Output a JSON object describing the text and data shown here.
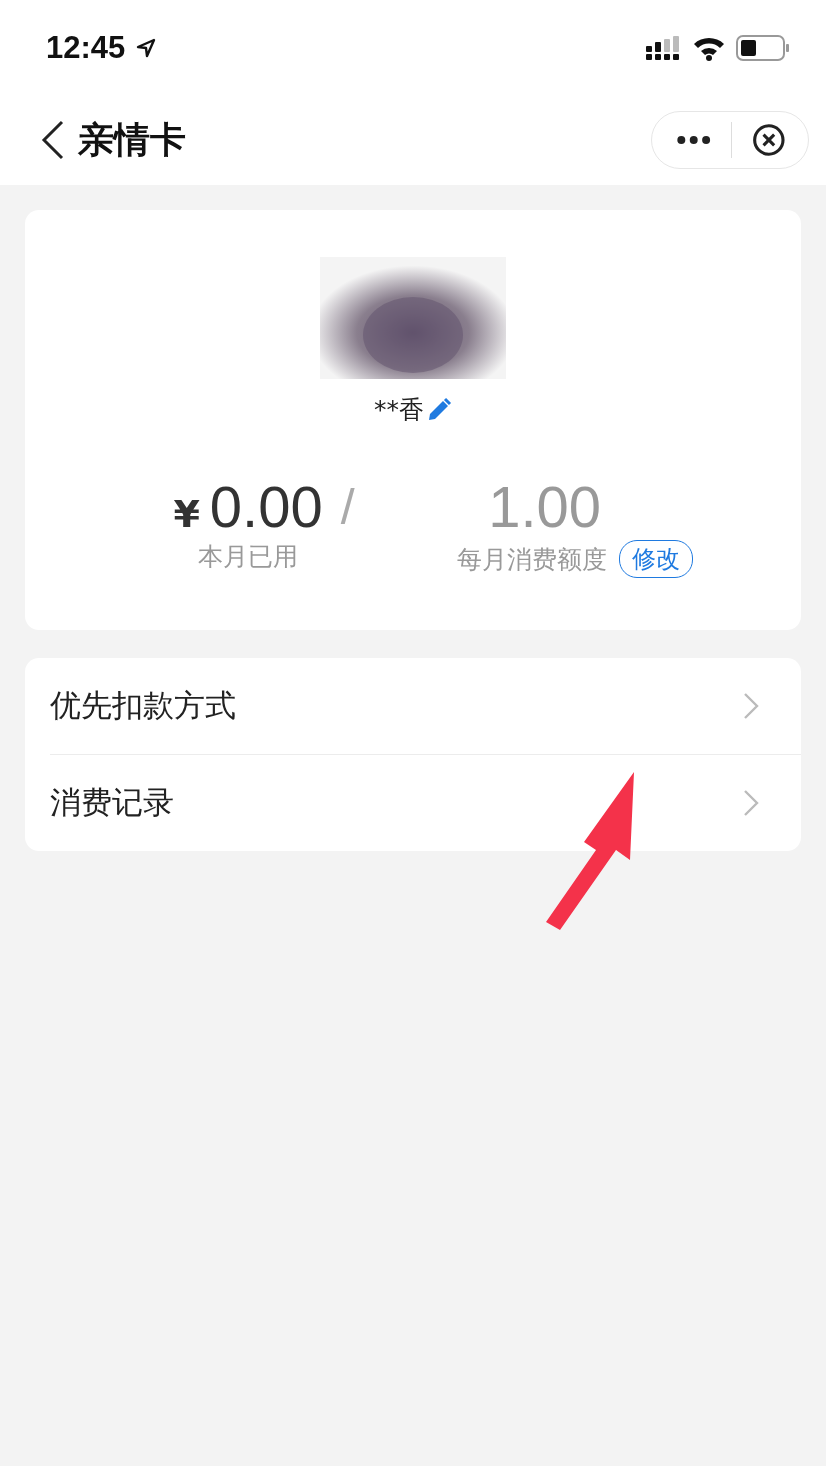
{
  "status_bar": {
    "time": "12:45"
  },
  "nav": {
    "title": "亲情卡"
  },
  "profile": {
    "name": "**香"
  },
  "amounts": {
    "currency": "¥",
    "used": "0.00",
    "separator": "/",
    "limit": "1.00",
    "used_label": "本月已用",
    "limit_label": "每月消费额度",
    "edit_button": "修改"
  },
  "menu": [
    {
      "label": "优先扣款方式"
    },
    {
      "label": "消费记录"
    }
  ]
}
